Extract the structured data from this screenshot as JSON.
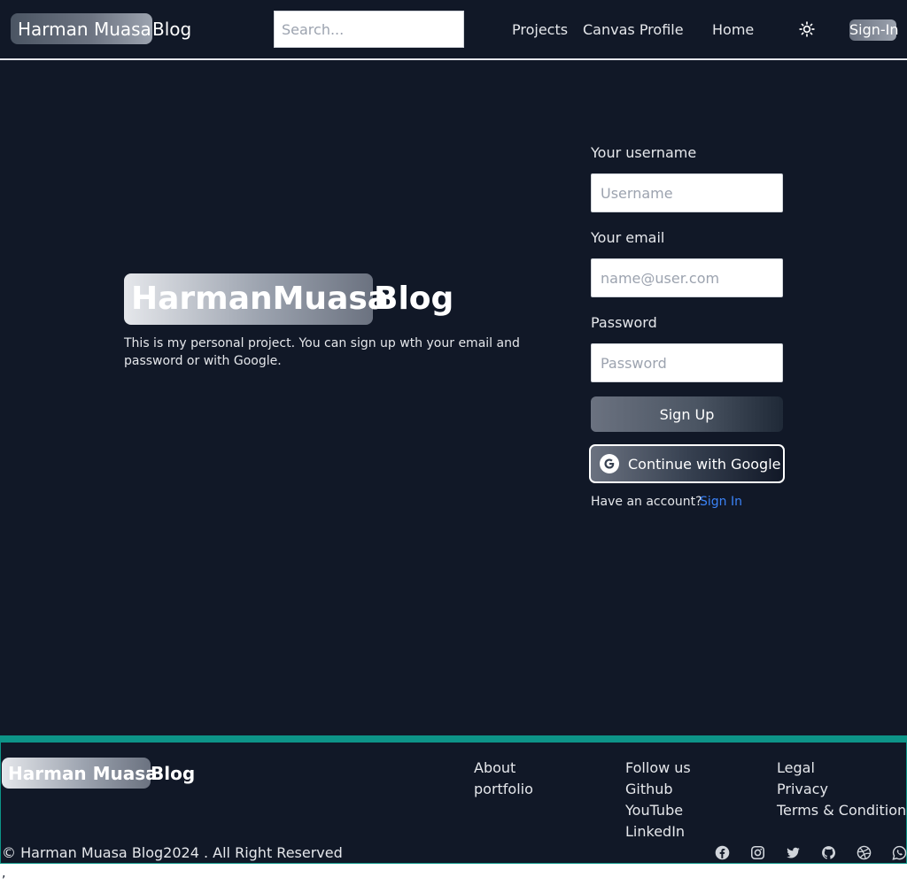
{
  "header": {
    "brand_left": "Harman Muasa",
    "brand_right": "Blog",
    "search_placeholder": "Search...",
    "nav": [
      "Projects",
      "Canvas Profile",
      "Home"
    ],
    "theme_icon": "sun-icon",
    "signin_label": "Sign-In"
  },
  "hero": {
    "title_left": "HarmanMuasa",
    "title_right": "Blog",
    "description": "This is my personal project. You can sign up wth your email and password or with Google."
  },
  "form": {
    "username_label": "Your username",
    "username_placeholder": "Username",
    "email_label": "Your email",
    "email_placeholder": "name@user.com",
    "password_label": "Password",
    "password_placeholder": "Password",
    "signup_label": "Sign Up",
    "google_label": "Continue with Google",
    "have_account": "Have an account?",
    "signin_link": "Sign In"
  },
  "footer": {
    "brand_left": "Harman Muasa",
    "brand_right": "Blog",
    "about": {
      "title": "About",
      "links": [
        "portfolio"
      ]
    },
    "follow": {
      "title": "Follow us",
      "links": [
        "Github",
        "YouTube",
        "LinkedIn"
      ]
    },
    "legal": {
      "title": "Legal",
      "links": [
        "Privacy",
        "Terms & Conditions"
      ]
    },
    "copyright": "© Harman Muasa Blog2024 . All Right Reserved",
    "social_icons": [
      "facebook-icon",
      "instagram-icon",
      "twitter-icon",
      "github-icon",
      "dribbble-icon",
      "whatsapp-icon"
    ]
  },
  "stray_text": ",",
  "colors": {
    "background": "#111827",
    "footer_border": "#0d9488",
    "link_blue": "#3b82f6"
  }
}
